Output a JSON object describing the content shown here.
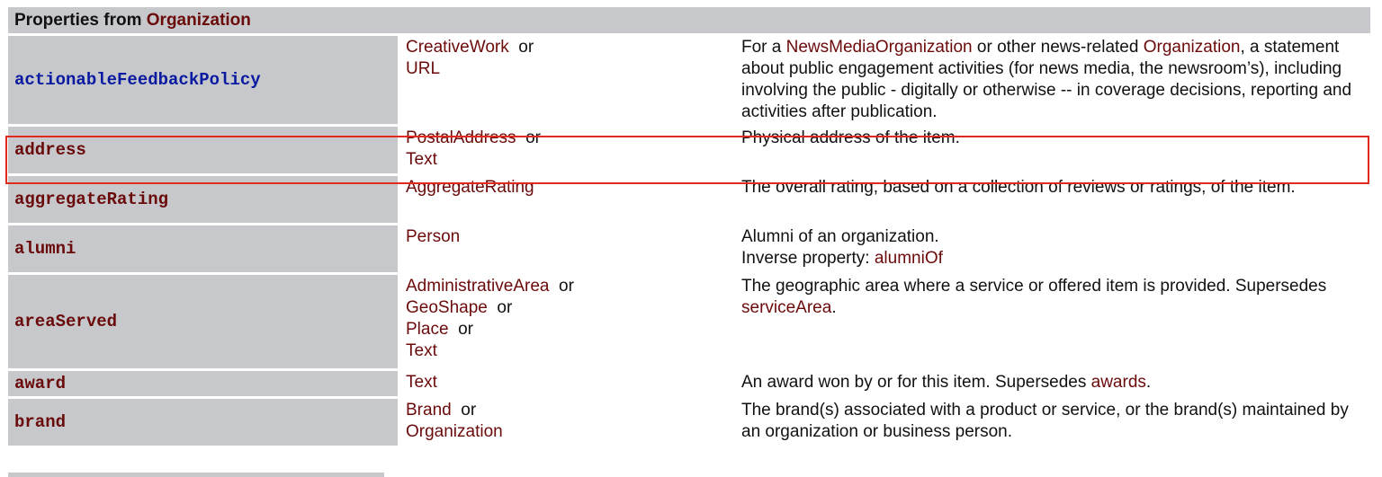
{
  "section": {
    "prefix": "Properties from ",
    "link": "Organization"
  },
  "rows": [
    {
      "property": "actionableFeedbackPolicy",
      "types": [
        "CreativeWork",
        "URL"
      ],
      "desc": [
        {
          "t": "text",
          "v": "For a "
        },
        {
          "t": "link",
          "v": "NewsMediaOrganization"
        },
        {
          "t": "text",
          "v": " or other news-related "
        },
        {
          "t": "link",
          "v": "Organization"
        },
        {
          "t": "text",
          "v": ", a statement about public engagement activities (for news media, the newsroom’s), including involving the public - digitally or otherwise -- in coverage decisions, reporting and activities after publication."
        }
      ]
    },
    {
      "property": "address",
      "types": [
        "PostalAddress",
        "Text"
      ],
      "desc": [
        {
          "t": "text",
          "v": "Physical address of the item."
        }
      ]
    },
    {
      "property": "aggregateRating",
      "types": [
        "AggregateRating"
      ],
      "desc": [
        {
          "t": "text",
          "v": "The overall rating, based on a collection of reviews or ratings, of the item."
        }
      ]
    },
    {
      "property": "alumni",
      "types": [
        "Person"
      ],
      "desc": [
        {
          "t": "text",
          "v": "Alumni of an organization."
        },
        {
          "t": "br"
        },
        {
          "t": "text",
          "v": "Inverse property: "
        },
        {
          "t": "link",
          "v": "alumniOf"
        }
      ]
    },
    {
      "property": "areaServed",
      "types": [
        "AdministrativeArea",
        "GeoShape",
        "Place",
        "Text"
      ],
      "desc": [
        {
          "t": "text",
          "v": "The geographic area where a service or offered item is provided. Supersedes "
        },
        {
          "t": "link",
          "v": "serviceArea"
        },
        {
          "t": "text",
          "v": "."
        }
      ]
    },
    {
      "property": "award",
      "types": [
        "Text"
      ],
      "desc": [
        {
          "t": "text",
          "v": "An award won by or for this item. Supersedes "
        },
        {
          "t": "link",
          "v": "awards"
        },
        {
          "t": "text",
          "v": "."
        }
      ]
    },
    {
      "property": "brand",
      "types": [
        "Brand",
        "Organization"
      ],
      "desc": [
        {
          "t": "text",
          "v": "The brand(s) associated with a product or service, or the brand(s) maintained by an organization or business person."
        }
      ]
    }
  ],
  "or_word": "or",
  "colors": {
    "link": "#6b0a0a",
    "first_property": "#0a1aa0",
    "header_bg": "#c6c8cb",
    "highlight": "#e02a1e"
  }
}
